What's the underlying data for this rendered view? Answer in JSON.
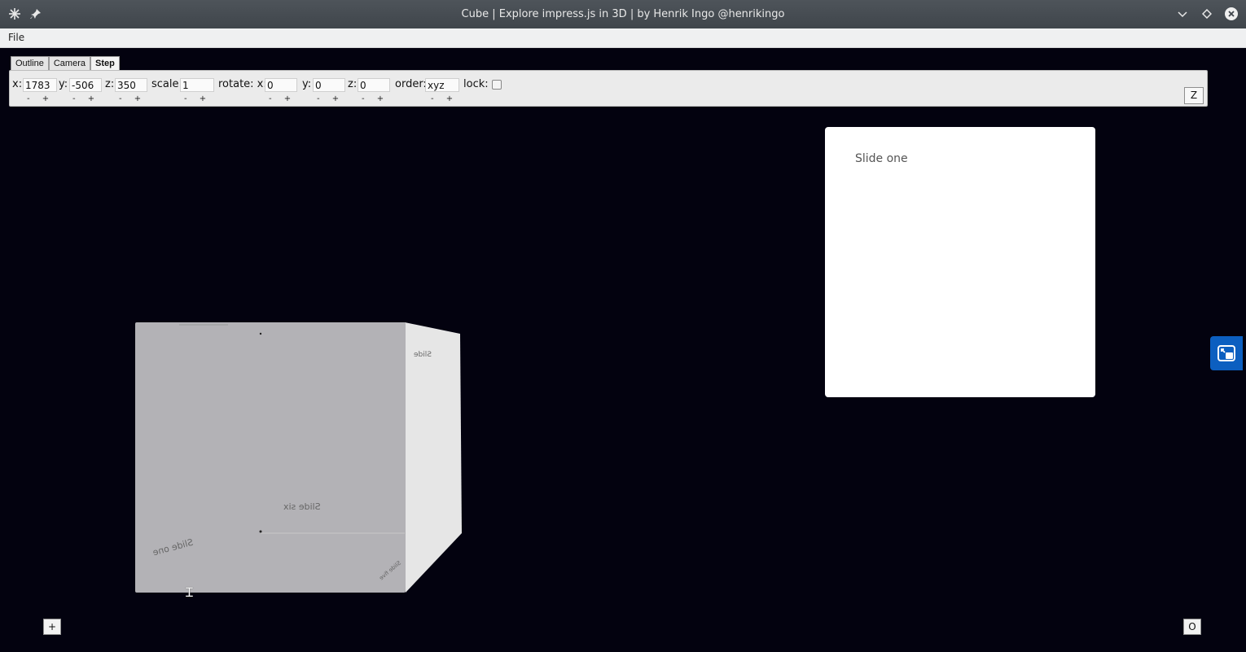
{
  "window": {
    "title": "Cube | Explore impress.js in 3D | by Henrik Ingo @henrikingo"
  },
  "menu": {
    "file": "File"
  },
  "tabs": [
    {
      "label": "Outline",
      "active": false
    },
    {
      "label": "Camera",
      "active": false
    },
    {
      "label": "Step",
      "active": true
    }
  ],
  "step_fields": {
    "x": {
      "label": "x:",
      "value": "1783"
    },
    "y": {
      "label": "y:",
      "value": "-506"
    },
    "z": {
      "label": "z:",
      "value": "350"
    },
    "scale": {
      "label": "scale:",
      "value": "1"
    },
    "rotate_label": "rotate: x:",
    "rotate_x": {
      "value": "0"
    },
    "rotate_y": {
      "label": "y:",
      "value": "0"
    },
    "rotate_z": {
      "label": "z:",
      "value": "0"
    },
    "order": {
      "label": "order:",
      "value": "xyz"
    },
    "lock": {
      "label": "lock:",
      "checked": false
    },
    "stepper_minus": "-",
    "stepper_plus": "+",
    "z_button": "Z"
  },
  "slide": {
    "text": "Slide one"
  },
  "cube": {
    "front_text": "Slide six",
    "left_text": "Slide one",
    "side_text": "Slide",
    "corner_text": "Slide five"
  },
  "buttons": {
    "add": "+",
    "overview": "O"
  },
  "colors": {
    "background": "#03020f",
    "pip_button": "#0c5fc0"
  }
}
